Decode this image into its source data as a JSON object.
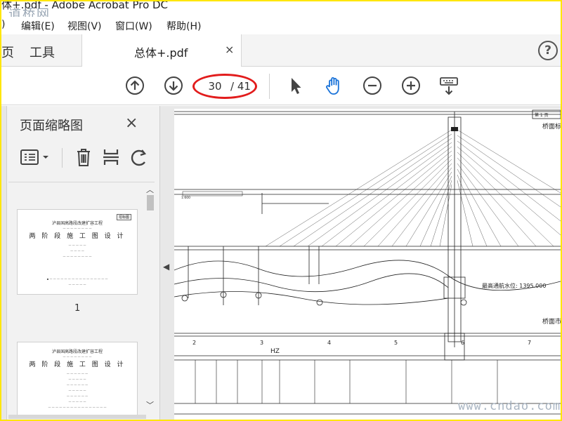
{
  "window": {
    "title": "体+.pdf - Adobe Acrobat Pro DC",
    "watermark_top": "道桥网",
    "watermark_bottom": "www.cndao.com"
  },
  "menu": {
    "items": [
      ")",
      "编辑(E)",
      "视图(V)",
      "窗口(W)",
      "帮助(H)"
    ]
  },
  "tabs": {
    "home_partial": "页",
    "tools": "工具",
    "document": "总体+.pdf",
    "close_glyph": "×",
    "help_glyph": "?"
  },
  "toolbar": {
    "page_current": "30",
    "page_total": "/ 41",
    "icons": [
      "arrow-up-circle-icon",
      "arrow-down-circle-icon",
      "select-pointer-icon",
      "hand-tool-icon",
      "zoom-out-icon",
      "zoom-in-icon",
      "keyboard-download-icon"
    ],
    "accent": "#1a73d9",
    "highlight": "#e21c1c"
  },
  "panel": {
    "title": "页面缩略图",
    "close_glyph": "×",
    "thumbnails": [
      {
        "number": "1",
        "org": "泸县国高路段改建扩容工程",
        "sub": "两 阶 段 施 工 图 设 计",
        "tag": "招标图"
      },
      {
        "org": "泸县国高路段改建扩容工程",
        "sub": "两 阶 段 施 工 图 设 计"
      }
    ]
  },
  "drawing": {
    "page_label": "第 1 页",
    "right_label_1": "桥面标",
    "right_label_2": "桥面市",
    "water_level": "最高通航水位: 1395.000",
    "scale_note": "1:600",
    "span_labels": [
      "2",
      "3",
      "4",
      "5",
      "6",
      "7"
    ],
    "hz": "HZ"
  }
}
